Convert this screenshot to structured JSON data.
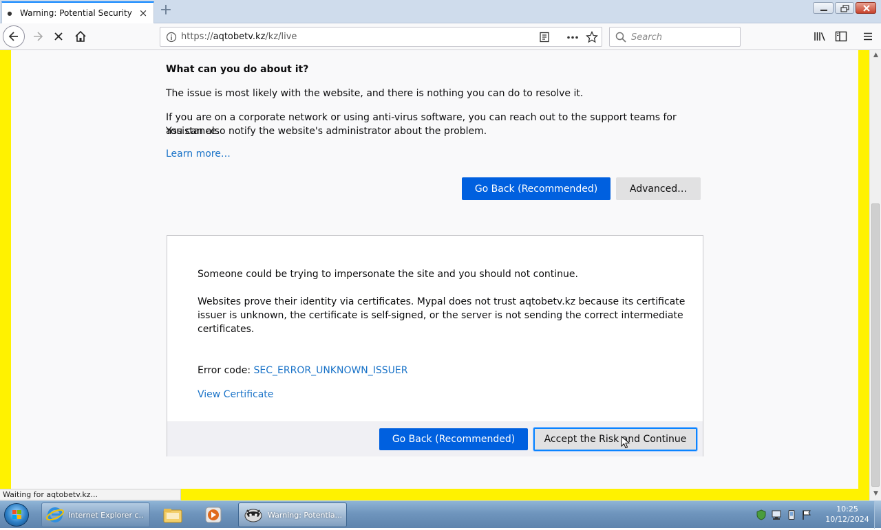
{
  "browser": {
    "tab": {
      "title": "Warning: Potential Security Risk Ahead"
    },
    "url": {
      "prefix": "https://",
      "domain": "aqtobetv.kz",
      "path": "/kz/live"
    },
    "search": {
      "placeholder": "Search"
    },
    "status_text": "Waiting for aqtobetv.kz..."
  },
  "page": {
    "heading": "What can you do about it?",
    "para1": "The issue is most likely with the website, and there is nothing you can do to resolve it.",
    "para2_line1": "If you are on a corporate network or using anti-virus software, you can reach out to the support teams for assistance.",
    "para2_line2": "You can also notify the website's administrator about the problem.",
    "learn_more": "Learn more…",
    "go_back_label": "Go Back (Recommended)",
    "advanced_label": "Advanced…",
    "advanced_panel": {
      "warning": "Someone could be trying to impersonate the site and you should not continue.",
      "detail_line1": "Websites prove their identity via certificates. Mypal does not trust aqtobetv.kz because its certificate",
      "detail_line2": "issuer is unknown, the certificate is self-signed, or the server is not sending the correct intermediate",
      "detail_line3": "certificates.",
      "error_code_label": "Error code: ",
      "error_code": "SEC_ERROR_UNKNOWN_ISSUER",
      "view_certificate": "View Certificate",
      "go_back_label": "Go Back (Recommended)",
      "accept_label": "Accept the Risk and Continue"
    }
  },
  "taskbar": {
    "ie_label": "Internet Explorer c...",
    "browser_label": "Warning: Potentia...",
    "clock_time": "10:25",
    "clock_date": "10/12/2024"
  },
  "colors": {
    "accent": "#0060df",
    "link": "#1a73c8",
    "border_yellow": "#fff200"
  }
}
